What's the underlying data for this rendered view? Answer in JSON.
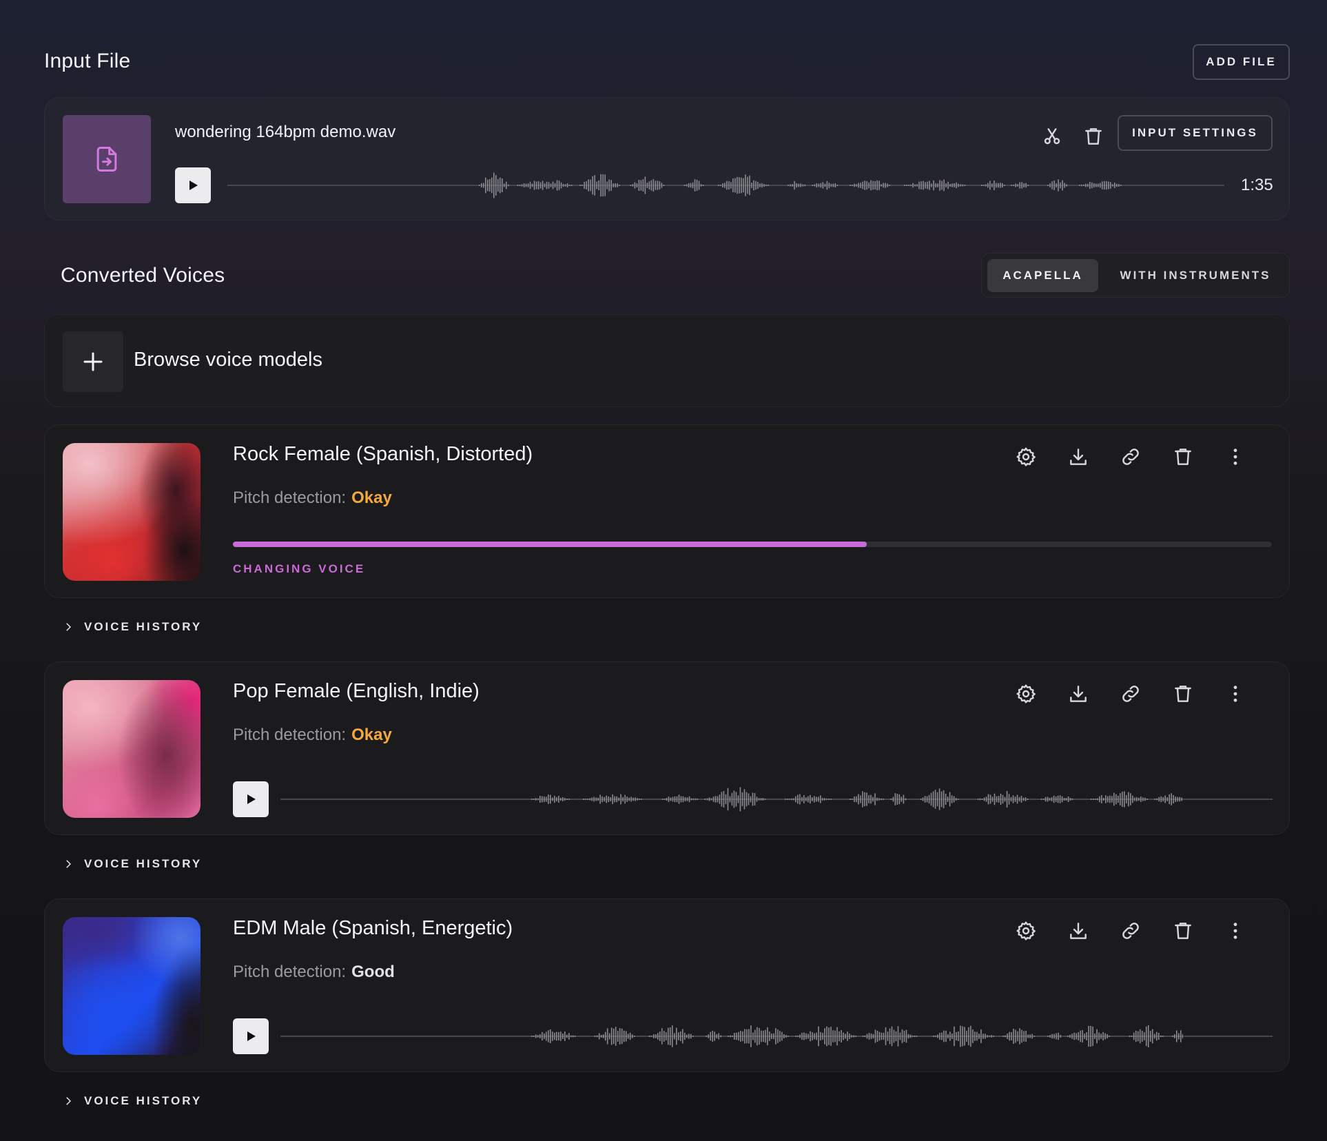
{
  "input_section": {
    "title": "Input File",
    "add_file_label": "ADD FILE",
    "file": {
      "name": "wondering 164bpm demo.wav",
      "duration": "1:35",
      "settings_label": "INPUT SETTINGS"
    }
  },
  "converted_section": {
    "title": "Converted Voices",
    "tabs": [
      {
        "label": "ACAPELLA",
        "active": true
      },
      {
        "label": "WITH INSTRUMENTS",
        "active": false
      }
    ],
    "browse_label": "Browse voice models"
  },
  "voices": [
    {
      "name": "Rock Female (Spanish, Distorted)",
      "pitch_label": "Pitch detection:",
      "pitch_value": "Okay",
      "pitch_color": "#f4a93c",
      "status": "CHANGING VOICE",
      "progress": 0.61,
      "history_label": "VOICE HISTORY"
    },
    {
      "name": "Pop Female (English, Indie)",
      "pitch_label": "Pitch detection:",
      "pitch_value": "Okay",
      "pitch_color": "#f4a93c",
      "history_label": "VOICE HISTORY"
    },
    {
      "name": "EDM Male (Spanish, Energetic)",
      "pitch_label": "Pitch detection:",
      "pitch_value": "Good",
      "pitch_color": "#e2e2e6",
      "history_label": "VOICE HISTORY"
    }
  ],
  "colors": {
    "accent": "#c96bd6",
    "file_tile": "#5b3f6b",
    "file_icon": "#d57be0"
  },
  "icons": [
    "file-import-icon",
    "scissors-icon",
    "trash-icon",
    "play-icon",
    "plus-icon",
    "gear-icon",
    "download-icon",
    "link-icon",
    "more-vertical-icon",
    "chevron-right-icon"
  ]
}
